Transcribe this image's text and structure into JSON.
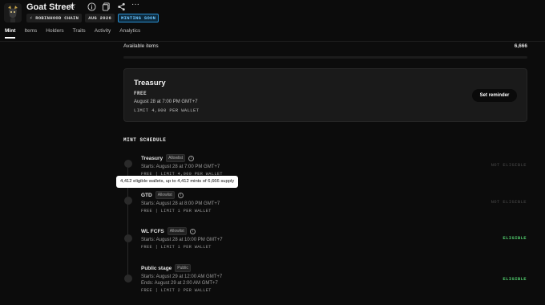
{
  "header": {
    "title": "Goat Street",
    "badges": {
      "chain": "ROBINHOOD CHAIN",
      "date": "AUG 2026",
      "status": "MINTING SOON"
    },
    "tabs": [
      "Mint",
      "Items",
      "Holders",
      "Traits",
      "Activity",
      "Analytics"
    ],
    "icons": [
      "star-icon",
      "info-icon",
      "copy-icon",
      "share-icon",
      "more-icon"
    ]
  },
  "available": {
    "label": "Available items",
    "value": "6,666"
  },
  "treasury_card": {
    "title": "Treasury",
    "price": "FREE",
    "date": "August 28 at 7:00 PM GMT+7",
    "limit": "LIMIT 4,000 PER WALLET",
    "button": "Set reminder"
  },
  "schedule": {
    "title": "MINT SCHEDULE",
    "stages": [
      {
        "name": "Treasury",
        "tag": "Allowlist",
        "line1": "Starts: August 28 at 7:00 PM GMT+7",
        "line2": "",
        "limit": "FREE | LIMIT 4,000 PER WALLET",
        "eligibility": "NOT ELIGIBLE"
      },
      {
        "name": "GTD",
        "tag": "Allowlist",
        "line1": "Starts: August 28 at 8:00 PM GMT+7",
        "line2": "",
        "limit": "FREE | LIMIT 1 PER WALLET",
        "eligibility": "NOT ELIGIBLE"
      },
      {
        "name": "WL FCFS",
        "tag": "Allowlist",
        "line1": "Starts: August 28 at 10:00 PM GMT+7",
        "line2": "",
        "limit": "FREE | LIMIT 1 PER WALLET",
        "eligibility": "ELIGIBLE"
      },
      {
        "name": "Public stage",
        "tag": "Public",
        "line1": "Starts: August 29 at 12:00 AM GMT+7",
        "line2": "Ends: August 29 at 2:00 AM GMT+7",
        "limit": "FREE | LIMIT 2 PER WALLET",
        "eligibility": "ELIGIBLE"
      }
    ]
  },
  "tooltip": "4,412 eligible wallets, up to 4,412 mints of 6,666 supply",
  "colors": {
    "background": "#0c0c0c",
    "card": "#1a1a1a",
    "eligible": "#4ec76a",
    "status_badge": "#2a8fd1"
  }
}
